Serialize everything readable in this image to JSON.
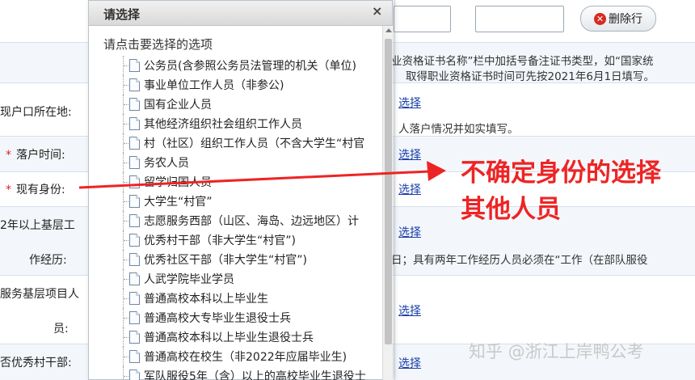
{
  "form": {
    "delete_row_button": "删除行",
    "rows": [
      {
        "label": "现户口所在地:",
        "required": false
      },
      {
        "label": "落户时间:",
        "required": true
      },
      {
        "label": "现有身份:",
        "required": true
      },
      {
        "label_line1": "2年以上基层工",
        "label_line2": "作经历:"
      },
      {
        "label_line1": "服务基层项目人",
        "label_line2": "员:"
      },
      {
        "label": "否优秀村干部:"
      }
    ],
    "notes": [
      "业资格证书名称”栏中加括号备注证书类型，如“国家统",
      "取得职业资格证书时间可先按2021年6月1日填写。",
      "人落户情况并如实填写。",
      "日；具有两年工作经历人员必须在“工作（在部队服役"
    ],
    "link_text": "选择"
  },
  "popup": {
    "title": "请选择",
    "close": "×",
    "subtitle": "请点击要选择的选项",
    "options": [
      "公务员(含参照公务员法管理的机关（单位)",
      "事业单位工作人员（非参公)",
      "国有企业人员",
      "其他经济组织社会组织工作人员",
      "村（社区）组织工作人员（不含大学生“村官",
      "务农人员",
      "留学归国人员",
      "大学生“村官”",
      "志愿服务西部（山区、海岛、边远地区）计",
      "优秀村干部（非大学生“村官”)",
      "优秀社区干部（非大学生“村官”)",
      "人武学院毕业学员",
      "普通高校本科以上毕业生",
      "普通高校大专毕业生退役士兵",
      "普通高校本科以上毕业生退役士兵",
      "普通高校在校生（非2022年应届毕业生)",
      "军队服役5年（含）以上的高校毕业生退役士"
    ]
  },
  "annotation": {
    "line1": "不确定身份的选择",
    "line2": "其他人员",
    "color": "#ee2424"
  },
  "watermark": "知乎 @浙江上岸鸭公考"
}
